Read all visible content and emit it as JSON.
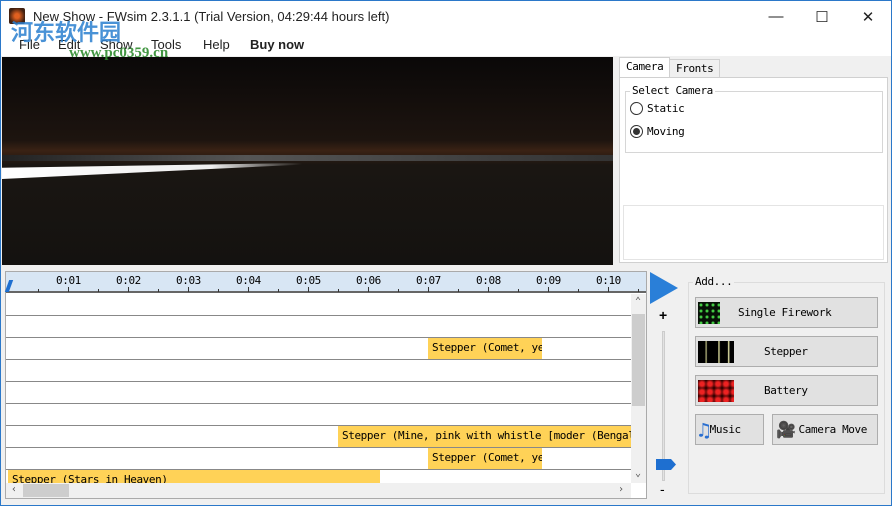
{
  "window": {
    "title": "New Show - FWsim 2.3.1.1 (Trial Version, 04:29:44 hours left)",
    "minimize": "—",
    "maximize": "☐",
    "close": "✕"
  },
  "watermark": {
    "text": "河东软件园",
    "url": "www.pc0359.cn"
  },
  "menu": [
    "File",
    "Edit",
    "Show",
    "Tools",
    "Help",
    "Buy now"
  ],
  "right_panel": {
    "tabs": [
      "Camera",
      "Fronts"
    ],
    "active_tab": "Camera",
    "group_label": "Select Camera",
    "options": [
      {
        "label": "Static",
        "selected": false
      },
      {
        "label": "Moving",
        "selected": true
      }
    ]
  },
  "timeline": {
    "ticks": [
      "0:01",
      "0:02",
      "0:03",
      "0:04",
      "0:05",
      "0:06",
      "0:07",
      "0:08",
      "0:09",
      "0:10"
    ],
    "events": [
      {
        "row": 2,
        "start": 7.0,
        "end": 8.9,
        "label": "Stepper (Comet, yel"
      },
      {
        "row": 6,
        "start": 5.5,
        "end": 10.4,
        "label": "Stepper (Mine, pink with whistle [moder (Bengal"
      },
      {
        "row": 7,
        "start": 7.0,
        "end": 8.9,
        "label": "Stepper (Comet, yel"
      },
      {
        "row": 8,
        "start": 0.0,
        "end": 6.2,
        "label": "Stepper (Stars in Heaven)"
      }
    ],
    "colors": {
      "event": "#ffd257",
      "ruler": "#d8e6f4"
    }
  },
  "zoom": {
    "plus": "+",
    "minus": "-"
  },
  "add": {
    "label": "Add...",
    "buttons": [
      "Single Firework",
      "Stepper",
      "Battery",
      "Music",
      "Camera Move"
    ]
  }
}
